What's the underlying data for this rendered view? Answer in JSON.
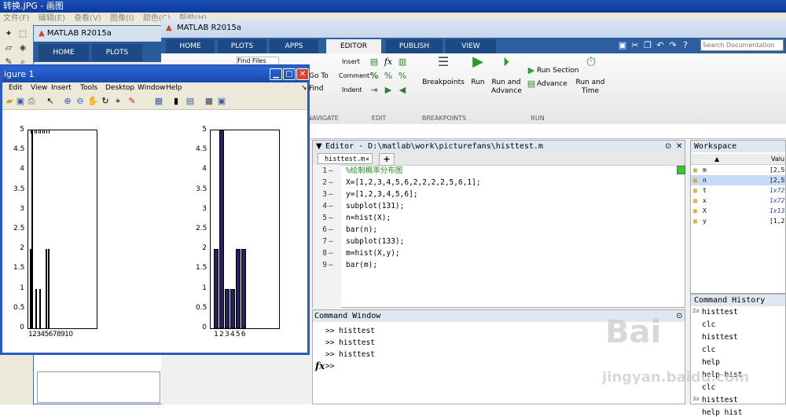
{
  "paint": {
    "title": "转换.JPG - 画图",
    "menu": [
      "文件(F)",
      "编辑(E)",
      "查看(V)",
      "图像(I)",
      "颜色(C)",
      "帮助(H)"
    ]
  },
  "matlab_back": {
    "title": "MATLAB R2015a",
    "tabs": [
      "HOME",
      "PLOTS"
    ]
  },
  "matlab": {
    "title": "MATLAB R2015a",
    "tabs": [
      "HOME",
      "PLOTS",
      "APPS",
      "EDITOR",
      "PUBLISH",
      "VIEW"
    ],
    "active_tab": "EDITOR",
    "search_placeholder": "Search Documentation",
    "toolstrip": {
      "find_files": "Find Files",
      "go_to": "Go To",
      "find": "Find",
      "nav_group": "NAVIGATE",
      "insert": "Insert",
      "comment": "Comment",
      "indent": "Indent",
      "edit_group": "EDIT",
      "breakpoints": "Breakpoints",
      "breakpoints_group": "BREAKPOINTS",
      "run": "Run",
      "run_and_advance": "Run and Advance",
      "run_section": "Run Section",
      "advance": "Advance",
      "run_and_time": "Run and Time",
      "run_group": "RUN"
    },
    "path": "picturefans"
  },
  "editor": {
    "title": "Editor - D:\\matlab\\work\\picturefans\\histtest.m",
    "file_tab": "histtest.m",
    "lines": [
      {
        "n": "1",
        "text": "%绘制概率分布图",
        "comment": true
      },
      {
        "n": "2",
        "text": "X=[1,2,3,4,5,6,2,2,2,2,5,6,1];",
        "comment": false
      },
      {
        "n": "3",
        "text": "y=[1,2,3,4,5,6];",
        "comment": false
      },
      {
        "n": "4",
        "text": "subplot(131);",
        "comment": false
      },
      {
        "n": "5",
        "text": "n=hist(X);",
        "comment": false
      },
      {
        "n": "6",
        "text": "bar(n);",
        "comment": false
      },
      {
        "n": "7",
        "text": "subplot(133);",
        "comment": false
      },
      {
        "n": "8",
        "text": "m=hist(X,y);",
        "comment": false
      },
      {
        "n": "9",
        "text": "bar(m);",
        "comment": false
      }
    ]
  },
  "command_window": {
    "title": "Command Window",
    "lines": [
      ">> histtest",
      ">> histtest",
      ">> histtest"
    ],
    "prompt": ">>",
    "fx": "fx"
  },
  "workspace": {
    "title": "Workspace",
    "col_value": "Valu",
    "rows": [
      {
        "name": "m",
        "value": "[2,5,"
      },
      {
        "name": "n",
        "value": "[2,5,"
      },
      {
        "name": "t",
        "value": "1x721"
      },
      {
        "name": "x",
        "value": "1x721"
      },
      {
        "name": "X",
        "value": "1x13"
      },
      {
        "name": "y",
        "value": "[1,2,"
      }
    ]
  },
  "history": {
    "title": "Command History",
    "lines": [
      "histtest",
      "clc",
      "histtest",
      "clc",
      "help",
      "help hist",
      "clc",
      "histtest",
      "help hist"
    ],
    "badge_2x": "2x",
    "badge_3x": "3x"
  },
  "figure": {
    "title": "igure 1",
    "menu": [
      "Edit",
      "View",
      "Insert",
      "Tools",
      "Desktop",
      "Window",
      "Help"
    ],
    "yticks": [
      "5",
      "4.5",
      "4",
      "3.5",
      "3",
      "2.5",
      "2",
      "1.5",
      "1",
      "0.5",
      "0"
    ],
    "left_xtick_label": "12345678910",
    "right_xticks": [
      "1",
      "2",
      "3",
      "4",
      "5",
      "6"
    ]
  },
  "chart_data": [
    {
      "type": "bar",
      "categories": [
        "1",
        "2",
        "3",
        "4",
        "5",
        "6",
        "7",
        "8",
        "9",
        "10"
      ],
      "values": [
        2,
        5,
        0,
        1,
        0,
        1,
        0,
        0,
        2,
        2
      ],
      "ylim": [
        0,
        5
      ],
      "title": "",
      "xlabel": "",
      "ylabel": ""
    },
    {
      "type": "bar",
      "categories": [
        "1",
        "2",
        "3",
        "4",
        "5",
        "6"
      ],
      "values": [
        2,
        5,
        1,
        1,
        2,
        2
      ],
      "ylim": [
        0,
        5
      ],
      "title": "",
      "xlabel": "",
      "ylabel": ""
    }
  ],
  "watermark": {
    "brand": "Bai",
    "sub": "jingyan.baidu.com"
  }
}
